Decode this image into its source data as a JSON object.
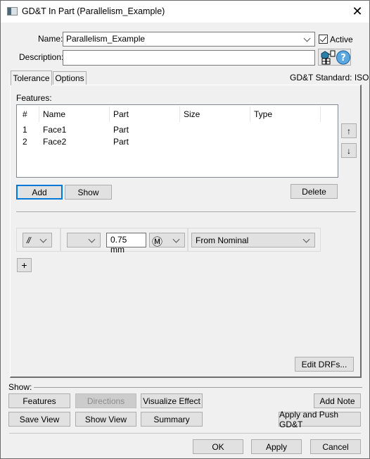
{
  "window": {
    "title": "GD&T In Part (Parallelism_Example)",
    "close_glyph": "✕"
  },
  "form": {
    "name_label": "Name:",
    "name_value": "Parallelism_Example",
    "active_label": "Active",
    "active_checked": true,
    "description_label": "Description:",
    "description_value": ""
  },
  "tabs": [
    {
      "label": "Tolerance",
      "selected": true
    },
    {
      "label": "Options",
      "selected": false
    }
  ],
  "standard_label": "GD&T Standard: ISO",
  "features": {
    "label": "Features:",
    "columns": [
      "#",
      "Name",
      "Part",
      "Size",
      "Type"
    ],
    "rows": [
      {
        "num": "1",
        "name": "Face1",
        "part": "Part",
        "size": "",
        "type": ""
      },
      {
        "num": "2",
        "name": "Face2",
        "part": "Part",
        "size": "",
        "type": ""
      }
    ],
    "move_up_glyph": "↑",
    "move_down_glyph": "↓",
    "add_label": "Add",
    "show_label": "Show",
    "delete_label": "Delete"
  },
  "feature_control_frame": {
    "characteristic_symbol": "//",
    "diameter_modifier": "",
    "tolerance_value": "0.75 mm",
    "material_modifier": "Ⓜ",
    "zone_mode": "From Nominal",
    "add_segment_label": "+"
  },
  "edit_drfs_label": "Edit DRFs...",
  "show_section": {
    "label": "Show:",
    "buttons": {
      "features": "Features",
      "directions": "Directions",
      "visualize_effect": "Visualize Effect",
      "add_note": "Add Note",
      "save_view": "Save View",
      "show_view": "Show View",
      "summary": "Summary",
      "apply_and_push": "Apply and Push GD&T"
    }
  },
  "footer": {
    "ok": "OK",
    "apply": "Apply",
    "cancel": "Cancel"
  }
}
